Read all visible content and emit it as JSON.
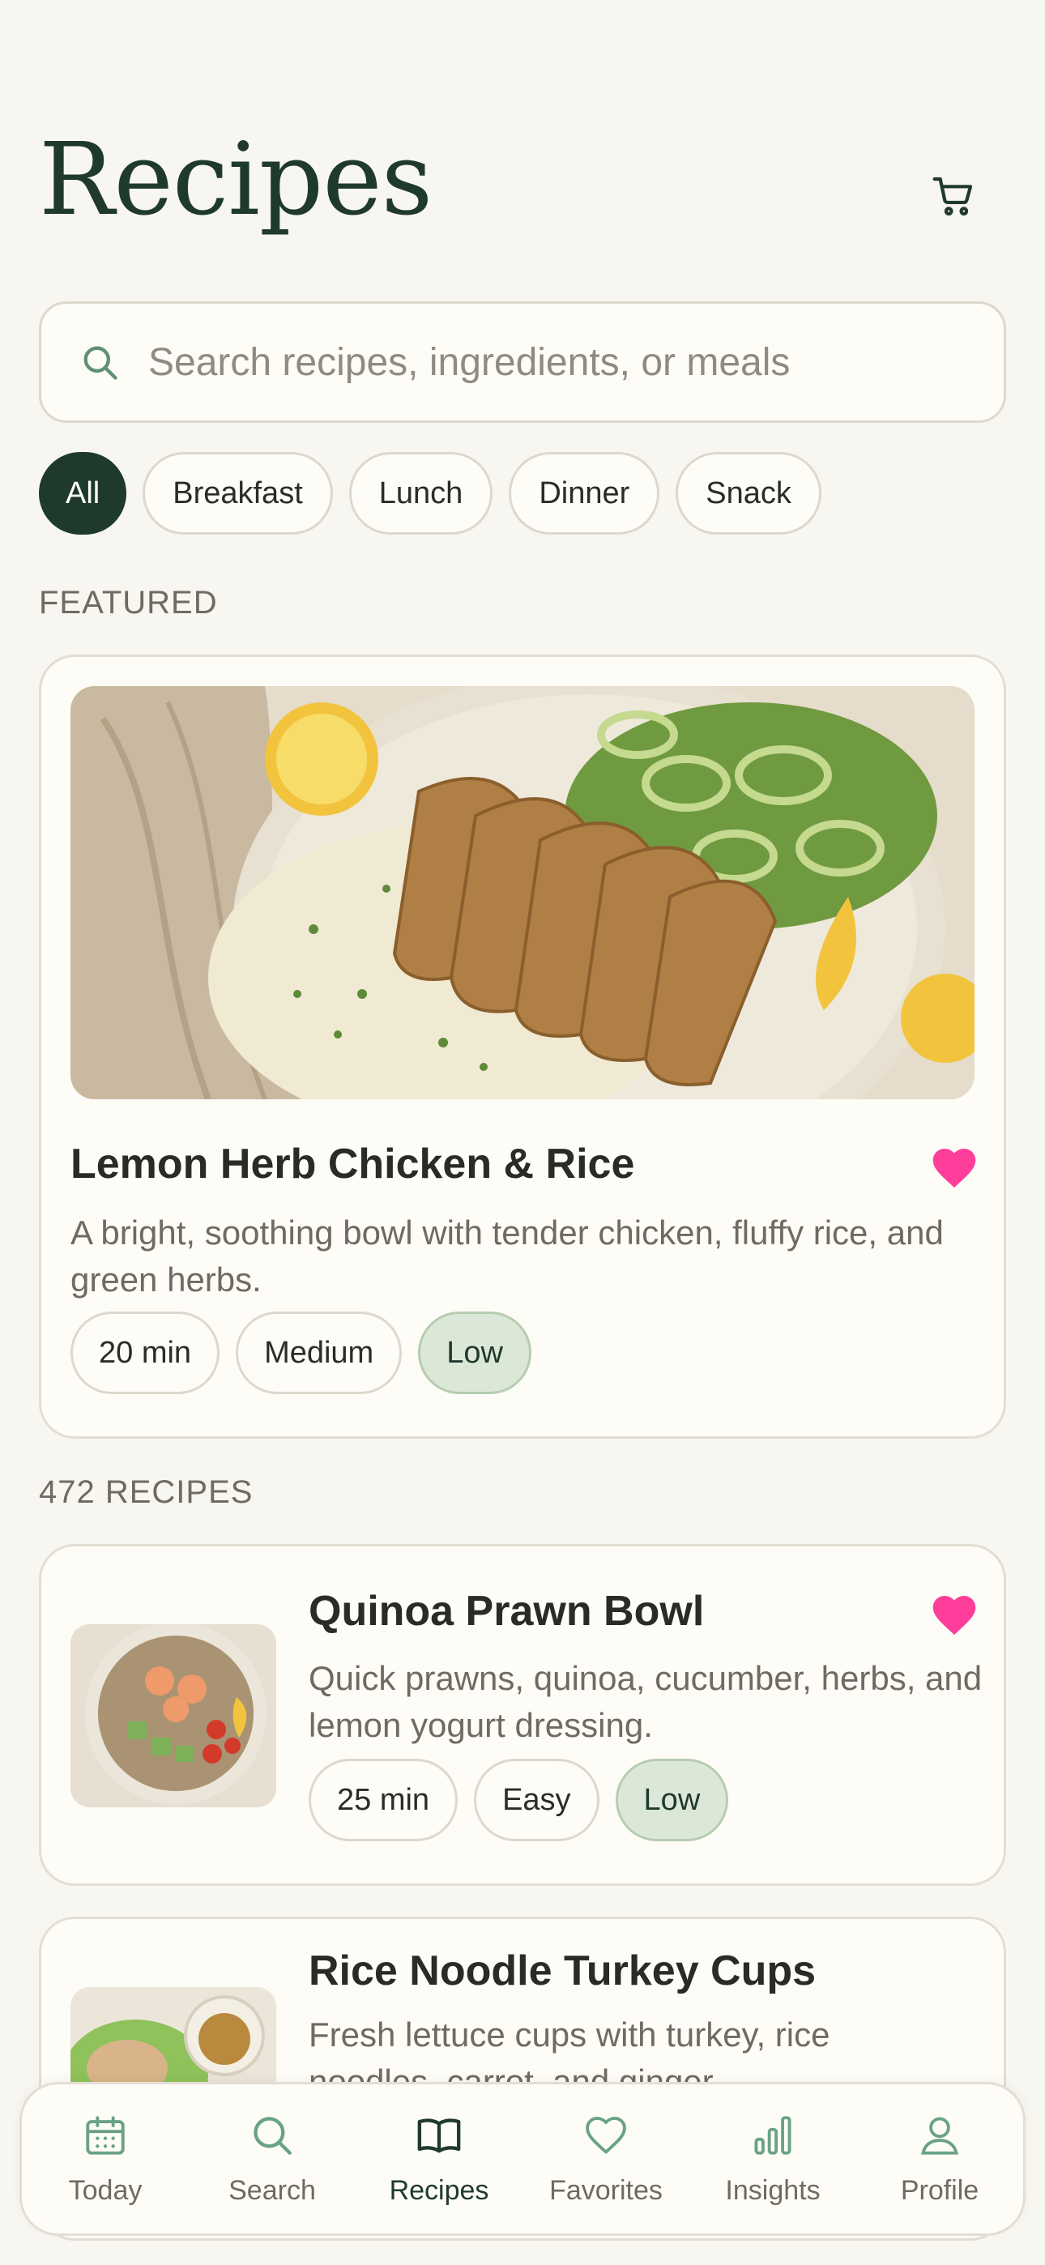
{
  "header": {
    "title": "Recipes",
    "cart_icon": "shopping-cart-icon"
  },
  "search": {
    "placeholder": "Search recipes, ingredients, or meals",
    "value": "",
    "icon": "search-icon"
  },
  "filters": {
    "selected": "All",
    "items": [
      {
        "label": "All"
      },
      {
        "label": "Breakfast"
      },
      {
        "label": "Lunch"
      },
      {
        "label": "Dinner"
      },
      {
        "label": "Snack"
      }
    ]
  },
  "featured": {
    "section_label": "FEATURED",
    "title": "Lemon Herb Chicken & Rice",
    "description": "A bright, soothing bowl with tender chicken, fluffy rice, and green herbs.",
    "favorited": true,
    "tags": [
      "20 min",
      "Medium",
      "Low"
    ]
  },
  "recipes": {
    "count_label": "472 RECIPES",
    "items": [
      {
        "title": "Quinoa Prawn Bowl",
        "description": "Quick prawns, quinoa, cucumber, herbs, and lemon yogurt dressing.",
        "favorited": true,
        "tags": [
          "25 min",
          "Easy",
          "Low"
        ]
      },
      {
        "title": "Rice Noodle Turkey Cups",
        "description": "Fresh lettuce cups with turkey, rice noodles, carrot, and ginger."
      }
    ]
  },
  "nav": {
    "active": "Recipes",
    "items": [
      {
        "label": "Today",
        "icon": "calendar-icon"
      },
      {
        "label": "Search",
        "icon": "search-icon"
      },
      {
        "label": "Recipes",
        "icon": "book-icon"
      },
      {
        "label": "Favorites",
        "icon": "heart-icon"
      },
      {
        "label": "Insights",
        "icon": "bar-chart-icon"
      },
      {
        "label": "Profile",
        "icon": "person-icon"
      }
    ]
  },
  "colors": {
    "accent": "#1f3a2d",
    "heart": "#ff3d9a",
    "background": "#f7f6f1",
    "card": "#fefcf6",
    "tag_green": "#dce8d7"
  }
}
